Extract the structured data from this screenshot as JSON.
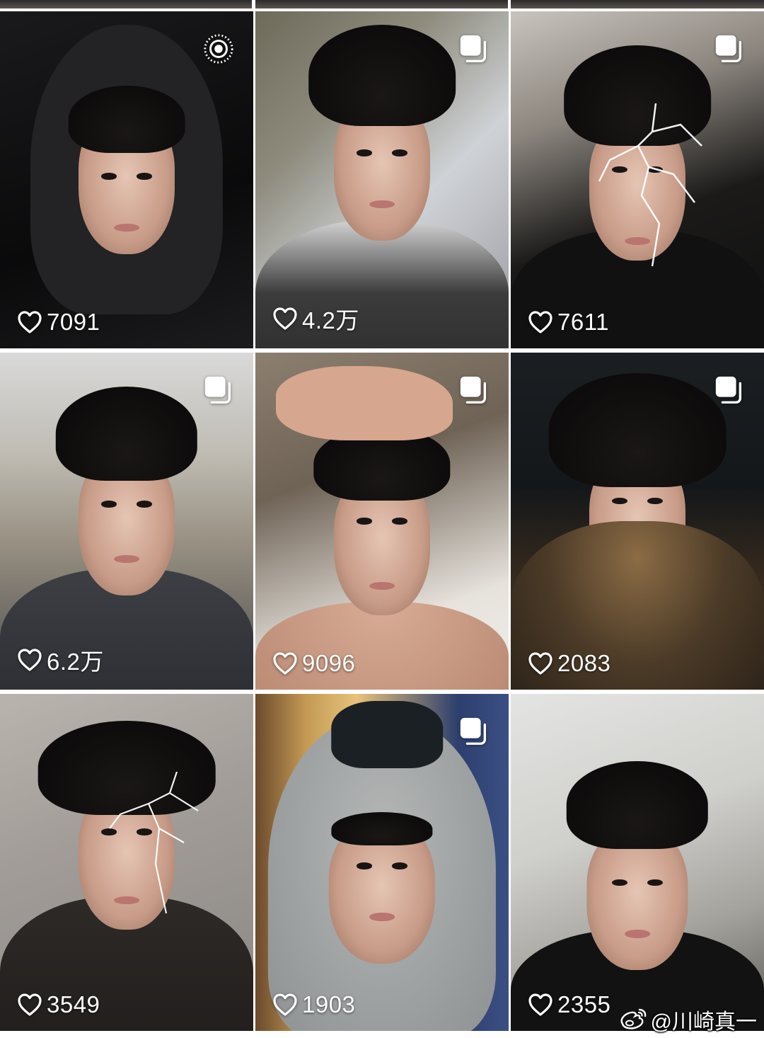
{
  "grid": {
    "tiles": [
      {
        "likes": "7091",
        "badge": "live-photo-icon"
      },
      {
        "likes": "4.2万",
        "badge": "multi-image-icon"
      },
      {
        "likes": "7611",
        "badge": "multi-image-icon"
      },
      {
        "likes": "6.2万",
        "badge": "multi-image-icon"
      },
      {
        "likes": "9096",
        "badge": "multi-image-icon"
      },
      {
        "likes": "2083",
        "badge": "multi-image-icon"
      },
      {
        "likes": "3549",
        "badge": "none"
      },
      {
        "likes": "1903",
        "badge": "multi-image-icon"
      },
      {
        "likes": "2355",
        "badge": "none"
      }
    ]
  },
  "watermark": {
    "handle": "@川崎真一",
    "icon": "weibo-icon"
  },
  "colors": {
    "like_text": "#ffffff",
    "background": "#ffffff"
  }
}
